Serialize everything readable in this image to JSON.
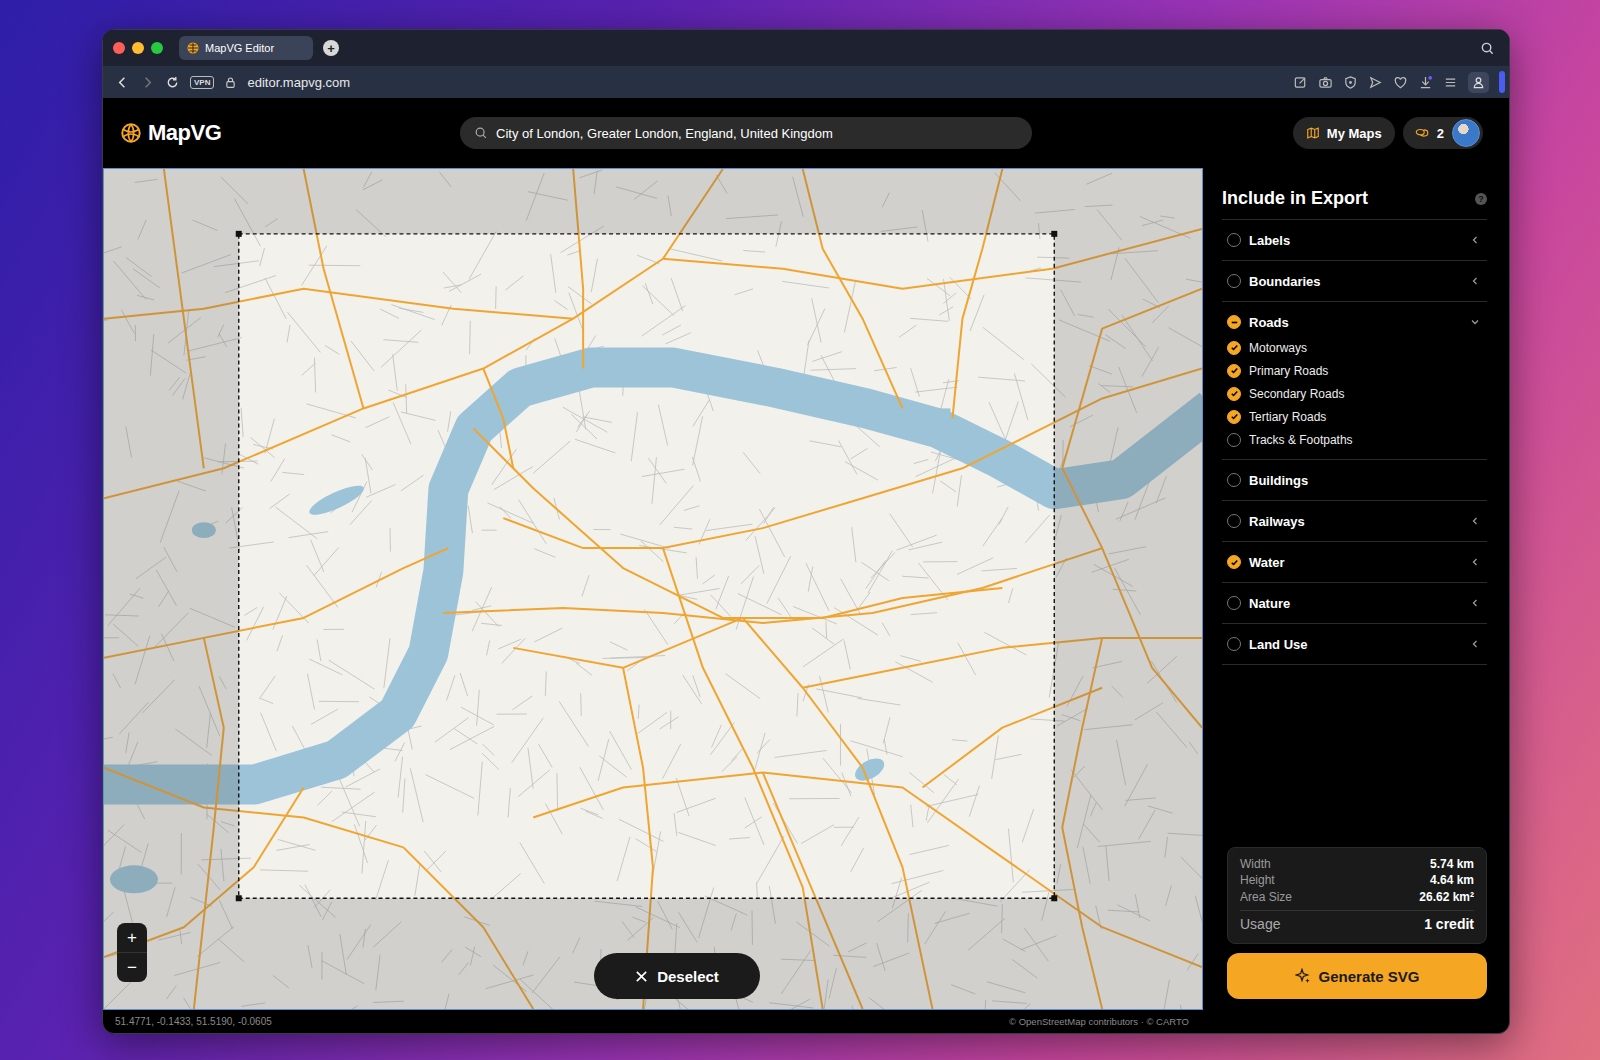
{
  "browser": {
    "tab_title": "MapVG Editor",
    "new_tab": "+",
    "vpn_badge": "VPN",
    "url": "editor.mapvg.com"
  },
  "app": {
    "logo": "MapVG",
    "search_value": "City of London, Greater London, England, United Kingdom",
    "my_maps": "My Maps",
    "credits": "2"
  },
  "map": {
    "deselect": "Deselect",
    "zoom_in": "+",
    "zoom_out": "−",
    "coordinates": "51.4771, -0.1433, 51.5190, -0.0605",
    "attribution": "© OpenStreetMap contributors · © CARTO"
  },
  "sidebar": {
    "title": "Include in Export",
    "help": "?",
    "layers": [
      {
        "label": "Labels",
        "checked": false,
        "partial": false,
        "expandable": true,
        "expanded": false,
        "children": []
      },
      {
        "label": "Boundaries",
        "checked": false,
        "partial": false,
        "expandable": true,
        "expanded": false,
        "children": []
      },
      {
        "label": "Roads",
        "checked": false,
        "partial": true,
        "expandable": true,
        "expanded": true,
        "children": [
          {
            "label": "Motorways",
            "checked": true
          },
          {
            "label": "Primary Roads",
            "checked": true
          },
          {
            "label": "Secondary Roads",
            "checked": true
          },
          {
            "label": "Tertiary Roads",
            "checked": true
          },
          {
            "label": "Tracks & Footpaths",
            "checked": false
          }
        ]
      },
      {
        "label": "Buildings",
        "checked": false,
        "partial": false,
        "expandable": false,
        "expanded": false,
        "children": []
      },
      {
        "label": "Railways",
        "checked": false,
        "partial": false,
        "expandable": true,
        "expanded": false,
        "children": []
      },
      {
        "label": "Water",
        "checked": true,
        "partial": false,
        "expandable": true,
        "expanded": false,
        "children": []
      },
      {
        "label": "Nature",
        "checked": false,
        "partial": false,
        "expandable": true,
        "expanded": false,
        "children": []
      },
      {
        "label": "Land Use",
        "checked": false,
        "partial": false,
        "expandable": true,
        "expanded": false,
        "children": []
      }
    ]
  },
  "stats": [
    {
      "label": "Width",
      "value": "5.74 km"
    },
    {
      "label": "Height",
      "value": "4.64 km"
    },
    {
      "label": "Area Size",
      "value": "26.62 km²"
    }
  ],
  "usage": {
    "label": "Usage",
    "value": "1 credit"
  },
  "generate_button": "Generate SVG"
}
